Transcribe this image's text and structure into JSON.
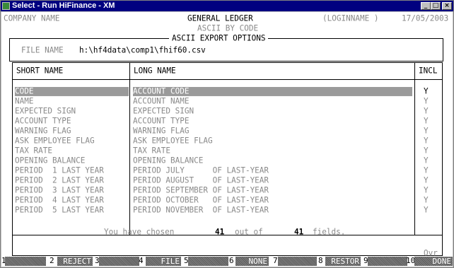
{
  "window": {
    "title": "Select - Run HiFinance - XM",
    "controls": [
      "_",
      "□",
      "×"
    ]
  },
  "header": {
    "company": "COMPANY NAME",
    "module": "GENERAL LEDGER",
    "submodule": "ASCII BY CODE",
    "user": "(LOGINNAME )",
    "date": "17/05/2003"
  },
  "options_box": {
    "title": "ASCII EXPORT OPTIONS",
    "file_label": "FILE NAME",
    "file_value": "h:\\hf4data\\comp1\\fhif60.csv"
  },
  "table": {
    "headers": {
      "short": "SHORT NAME",
      "long": "LONG NAME",
      "incl": "INCL"
    },
    "rows": [
      {
        "short": "CODE",
        "long": "ACCOUNT CODE",
        "incl": "Y"
      },
      {
        "short": "NAME",
        "long": "ACCOUNT NAME",
        "incl": "Y"
      },
      {
        "short": "EXPECTED SIGN",
        "long": "EXPECTED SIGN",
        "incl": "Y"
      },
      {
        "short": "ACCOUNT TYPE",
        "long": "ACCOUNT TYPE",
        "incl": "Y"
      },
      {
        "short": "WARNING FLAG",
        "long": "WARNING FLAG",
        "incl": "Y"
      },
      {
        "short": "ASK EMPLOYEE FLAG",
        "long": "ASK EMPLOYEE FLAG",
        "incl": "Y"
      },
      {
        "short": "TAX RATE",
        "long": "TAX RATE",
        "incl": "Y"
      },
      {
        "short": "OPENING BALANCE",
        "long": "OPENING BALANCE",
        "incl": "Y"
      },
      {
        "short": "PERIOD  1 LAST YEAR",
        "long": "PERIOD JULY      OF LAST-YEAR",
        "incl": "Y"
      },
      {
        "short": "PERIOD  2 LAST YEAR",
        "long": "PERIOD AUGUST    OF LAST-YEAR",
        "incl": "Y"
      },
      {
        "short": "PERIOD  3 LAST YEAR",
        "long": "PERIOD SEPTEMBER OF LAST-YEAR",
        "incl": "Y"
      },
      {
        "short": "PERIOD  4 LAST YEAR",
        "long": "PERIOD OCTOBER   OF LAST-YEAR",
        "incl": "Y"
      },
      {
        "short": "PERIOD  5 LAST YEAR",
        "long": "PERIOD NOVEMBER  OF LAST-YEAR",
        "incl": "Y"
      }
    ]
  },
  "status": {
    "prefix": "You have chosen",
    "chosen": "41",
    "middle": "out of",
    "total": "41",
    "suffix": "fields."
  },
  "ovr_label": "Ovr",
  "function_keys": [
    {
      "num": "1",
      "label": ""
    },
    {
      "num": "2",
      "label": "REJECT"
    },
    {
      "num": "3",
      "label": ""
    },
    {
      "num": "4",
      "label": "FILE"
    },
    {
      "num": "5",
      "label": ""
    },
    {
      "num": "6",
      "label": "NONE"
    },
    {
      "num": "7",
      "label": ""
    },
    {
      "num": "8",
      "label": "RESTOR"
    },
    {
      "num": "9",
      "label": ""
    },
    {
      "num": "10",
      "label": "DONE"
    }
  ]
}
